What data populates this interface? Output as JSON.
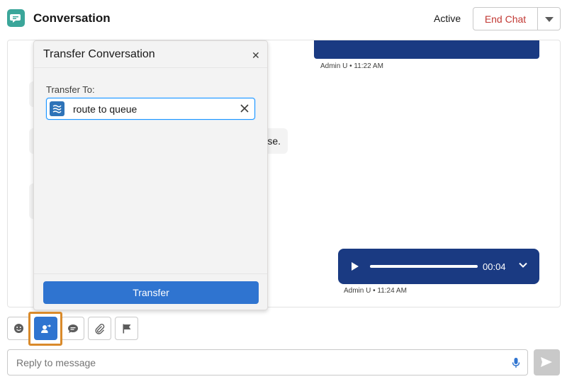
{
  "header": {
    "title": "Conversation",
    "status": "Active",
    "end_chat_label": "End Chat"
  },
  "chat": {
    "messages": [
      {
        "meta": "Admin U • 11:22 AM"
      },
      {
        "partial_text": "se."
      },
      {
        "audio_time": "00:04",
        "meta": "Admin U • 11:24 AM"
      }
    ]
  },
  "transfer_panel": {
    "title": "Transfer Conversation",
    "field_label": "Transfer To:",
    "value": "route to queue",
    "button_label": "Transfer"
  },
  "composer": {
    "placeholder": "Reply to message"
  },
  "colors": {
    "accent": "#2f74d0",
    "bubble": "#1a3a82",
    "end_chat": "#c23934",
    "highlight": "#d98a2b"
  },
  "toolbar": {
    "tools": [
      "emoji-icon",
      "transfer-icon",
      "quick-text-icon",
      "attachment-icon",
      "flag-icon"
    ],
    "active_tool": "transfer-icon"
  }
}
